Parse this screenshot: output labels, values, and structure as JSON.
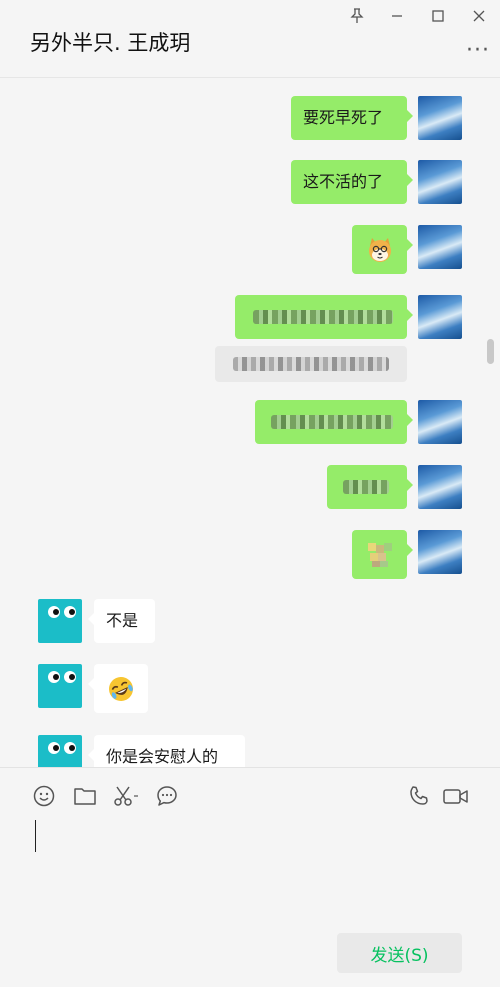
{
  "window": {
    "title": "另外半只. 王成玥",
    "controls": [
      "pin-icon",
      "minimize-icon",
      "maximize-icon",
      "close-icon"
    ],
    "more_icon": "more-icon"
  },
  "messages": [
    {
      "side": "self",
      "type": "text",
      "text": "要死早死了"
    },
    {
      "side": "self",
      "type": "text",
      "text": "这不活的了"
    },
    {
      "side": "self",
      "type": "sticker",
      "emoji": "shiba-dog-emoji"
    },
    {
      "side": "self",
      "type": "text",
      "text": "",
      "pixelated": true
    },
    {
      "side": "self",
      "type": "quote",
      "text": "",
      "pixelated": true
    },
    {
      "side": "self",
      "type": "text",
      "text": "",
      "pixelated": true
    },
    {
      "side": "self",
      "type": "text",
      "text": "",
      "pixelated": true
    },
    {
      "side": "self",
      "type": "sticker",
      "emoji": "",
      "pixelated": true
    },
    {
      "side": "other",
      "type": "text",
      "text": "不是"
    },
    {
      "side": "other",
      "type": "sticker",
      "emoji": "rolling-laughing-emoji"
    },
    {
      "side": "other",
      "type": "text",
      "text": "你是会安慰人的"
    }
  ],
  "toolbar": {
    "icons": [
      "emoji-icon",
      "folder-icon",
      "screenshot-icon",
      "chat-history-icon",
      "voice-call-icon",
      "video-call-icon"
    ]
  },
  "input": {
    "value": ""
  },
  "send_button": {
    "label": "发送(S)"
  },
  "colors": {
    "self_bubble": "#95ec69",
    "other_bubble": "#ffffff",
    "send_text": "#07c160"
  }
}
